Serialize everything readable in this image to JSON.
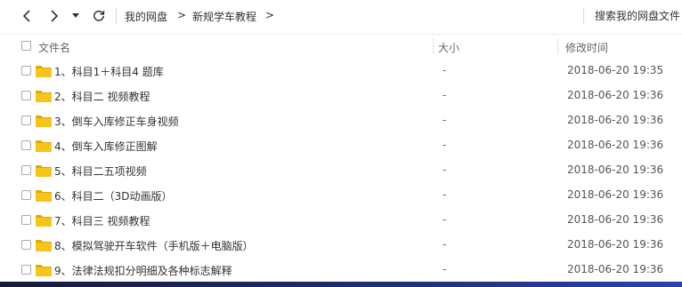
{
  "toolbar": {
    "breadcrumb": [
      "我的网盘",
      "新规学车教程"
    ],
    "breadcrumb_separator": ">",
    "search_placeholder": "搜索我的网盘文件"
  },
  "columns": {
    "name": "文件名",
    "size": "大小",
    "modified": "修改时间"
  },
  "rows": [
    {
      "name": "1、科目1＋科目4 题库",
      "size": "-",
      "modified": "2018-06-20 19:35"
    },
    {
      "name": "2、科目二 视频教程",
      "size": "-",
      "modified": "2018-06-20 19:36"
    },
    {
      "name": "3、倒车入库修正车身视频",
      "size": "-",
      "modified": "2018-06-20 19:36"
    },
    {
      "name": "4、倒车入库修正图解",
      "size": "-",
      "modified": "2018-06-20 19:36"
    },
    {
      "name": "5、科目二五项视频",
      "size": "-",
      "modified": "2018-06-20 19:36"
    },
    {
      "name": "6、科目二（3D动画版）",
      "size": "-",
      "modified": "2018-06-20 19:36"
    },
    {
      "name": "7、科目三 视频教程",
      "size": "-",
      "modified": "2018-06-20 19:36"
    },
    {
      "name": "8、模拟驾驶开车软件（手机版＋电脑版）",
      "size": "-",
      "modified": "2018-06-20 19:36"
    },
    {
      "name": "9、法律法规扣分明细及各种标志解释",
      "size": "-",
      "modified": "2018-06-20 19:36"
    }
  ],
  "icons": {
    "back": "back-arrow-icon",
    "forward": "forward-arrow-icon",
    "dropdown": "dropdown-caret-icon",
    "refresh": "refresh-icon",
    "folder": "folder-icon"
  },
  "colors": {
    "folder": "#f5c518",
    "folder_dark": "#e0a800",
    "text": "#333333",
    "muted": "#666666"
  }
}
